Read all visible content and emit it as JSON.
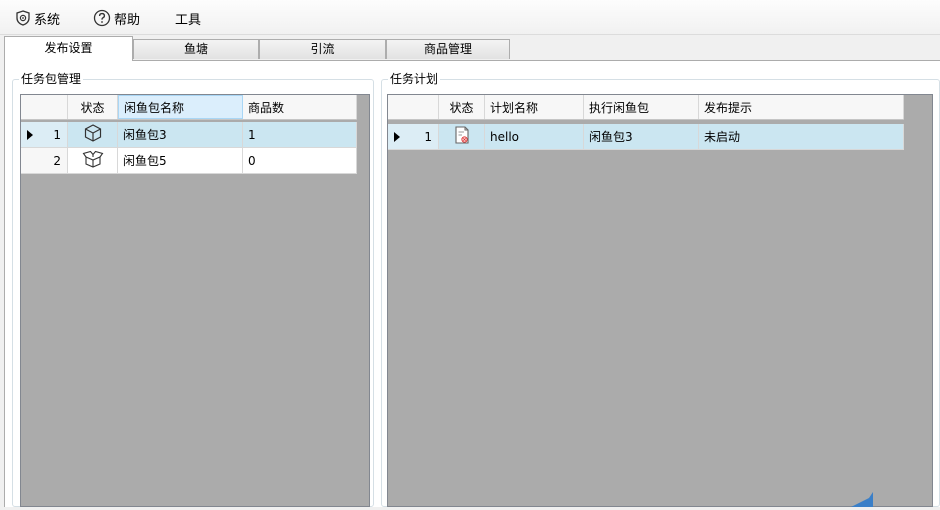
{
  "menu": {
    "items": [
      {
        "icon": "shield-gear-icon",
        "label": "系统"
      },
      {
        "icon": "help-icon",
        "label": "帮助"
      },
      {
        "icon": "",
        "label": "工具"
      }
    ]
  },
  "tabs": [
    {
      "label": "发布设置",
      "active": true
    },
    {
      "label": "鱼塘",
      "active": false
    },
    {
      "label": "引流",
      "active": false
    },
    {
      "label": "商品管理",
      "active": false
    }
  ],
  "left_panel": {
    "title": "任务包管理",
    "columns": [
      "状态",
      "闲鱼包名称",
      "商品数"
    ],
    "rows": [
      {
        "num": "1",
        "status_icon": "box-closed-icon",
        "name": "闲鱼包3",
        "count": "1",
        "selected": true
      },
      {
        "num": "2",
        "status_icon": "box-open-icon",
        "name": "闲鱼包5",
        "count": "0",
        "selected": false
      }
    ]
  },
  "right_panel": {
    "title": "任务计划",
    "columns": [
      "状态",
      "计划名称",
      "执行闲鱼包",
      "发布提示"
    ],
    "rows": [
      {
        "num": "1",
        "status_icon": "document-icon",
        "name": "hello",
        "package": "闲鱼包3",
        "hint": "未启动",
        "selected": true
      }
    ]
  },
  "colors": {
    "selected_row": "#cbe6f1",
    "grid_background": "#ababab",
    "sorted_header": "#dbeefc"
  }
}
